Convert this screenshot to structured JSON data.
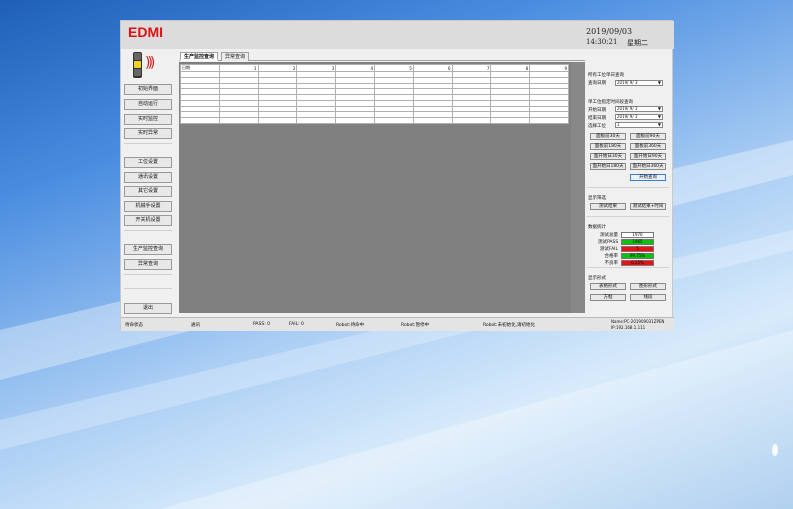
{
  "app": {
    "logo": "EDMI",
    "date": "2019/09/03",
    "time": "14:30:21",
    "weekday": "星期二"
  },
  "sidebar": {
    "group1": [
      "初始界面",
      "自动运行",
      "实时监控",
      "实时异常"
    ],
    "group2": [
      "工位设置",
      "通讯设置",
      "其它设置",
      "机械手设置",
      "开关机设置"
    ],
    "group3": [
      "生产监控查询",
      "异常查询"
    ],
    "exit_label": "退出"
  },
  "tabs": [
    {
      "label": "生产监控查询",
      "active": true
    },
    {
      "label": "异常查询",
      "active": false
    }
  ],
  "table": {
    "headers": [
      "日期",
      "1",
      "2",
      "3",
      "4",
      "5",
      "6",
      "7",
      "8",
      "9"
    ],
    "empty_rows": 9
  },
  "query_panel": {
    "all_title": "所有工位单日查询",
    "query_date_label": "查询日期",
    "query_date_value": "2019/ 9/ 3",
    "single_title": "单工位指定时间段查询",
    "start_date_label": "开始日期",
    "start_date_value": "2019/ 9/ 3",
    "end_date_label": "结束日期",
    "end_date_value": "2019/ 9/ 3",
    "station_label": "选择工位",
    "station_value": "1",
    "range_buttons": [
      "面板前30天",
      "面板前90天",
      "面板前180天",
      "面板前360天",
      "面开始日30天",
      "面开始日90天",
      "面开始日180天",
      "面开始日360天"
    ],
    "start_query_label": "开始查询"
  },
  "filter_panel": {
    "title": "显示筛选",
    "buttons": [
      "测试结果",
      "测试结果+时间"
    ]
  },
  "stats_panel": {
    "title": "数据统计",
    "rows": [
      {
        "label": "测试总量",
        "value": "1970",
        "color": "#ffffff"
      },
      {
        "label": "测试PASS",
        "value": "1965",
        "color": "#10c010"
      },
      {
        "label": "测试FAIL",
        "value": "5",
        "color": "#ee1010"
      },
      {
        "label": "合格率",
        "value": "99.75%",
        "color": "#10c010"
      },
      {
        "label": "不良率",
        "value": "0.25%",
        "color": "#ee1010"
      }
    ]
  },
  "display_panel": {
    "title": "显示形式",
    "buttons": [
      "表格形式",
      "图形形式",
      "方框",
      "线段"
    ]
  },
  "statusbar": {
    "items": [
      "待命状态",
      "通讯",
      "PASS: 0",
      "FAIL: 0",
      "Robot:待命中",
      "Robot:暂停中",
      "Robot:未初始化,请初始化"
    ],
    "host": "Name:PC-201909031ZPEN",
    "ip": "IP:192.168.1.111"
  }
}
